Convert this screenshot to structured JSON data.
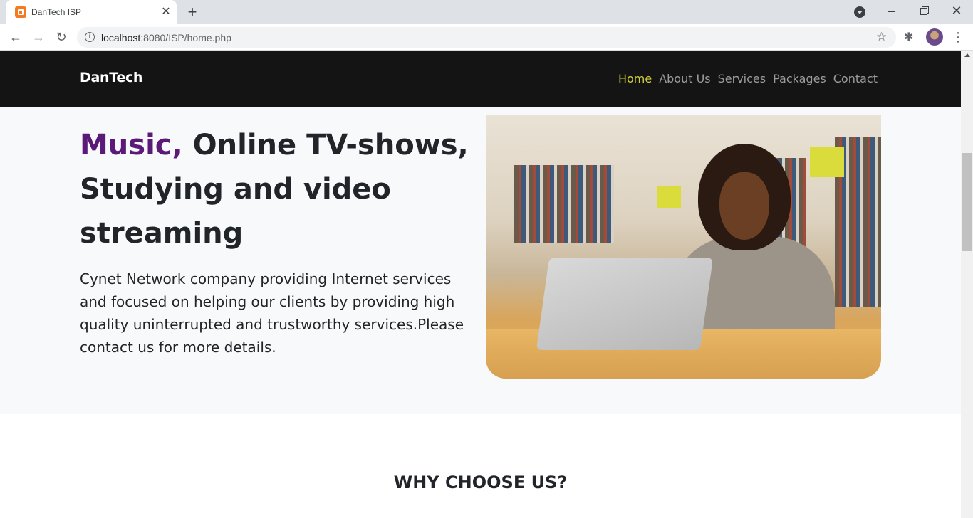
{
  "browser": {
    "tab_title": "DanTech ISP",
    "url_host": "localhost",
    "url_path": ":8080/ISP/home.php"
  },
  "site": {
    "brand": "DanTech",
    "nav": [
      {
        "label": "Home",
        "active": true
      },
      {
        "label": "About Us",
        "active": false
      },
      {
        "label": "Services",
        "active": false
      },
      {
        "label": "Packages",
        "active": false
      },
      {
        "label": "Contact",
        "active": false
      }
    ],
    "hero": {
      "title_accent": "Music,",
      "title_rest": " Online TV-shows, Studying and video streaming",
      "accent_color": "#5b1a78",
      "description": "Cynet Network company providing Internet services and focused on helping our clients by providing high quality uninterrupted and trustworthy services.Please contact us for more details."
    },
    "why_title": "WHY CHOOSE US?"
  },
  "colors": {
    "nav_bg": "#141414",
    "nav_active": "#d0cf3a",
    "nav_link": "#9b9b9b",
    "hero_bg": "#f8f9fa"
  }
}
